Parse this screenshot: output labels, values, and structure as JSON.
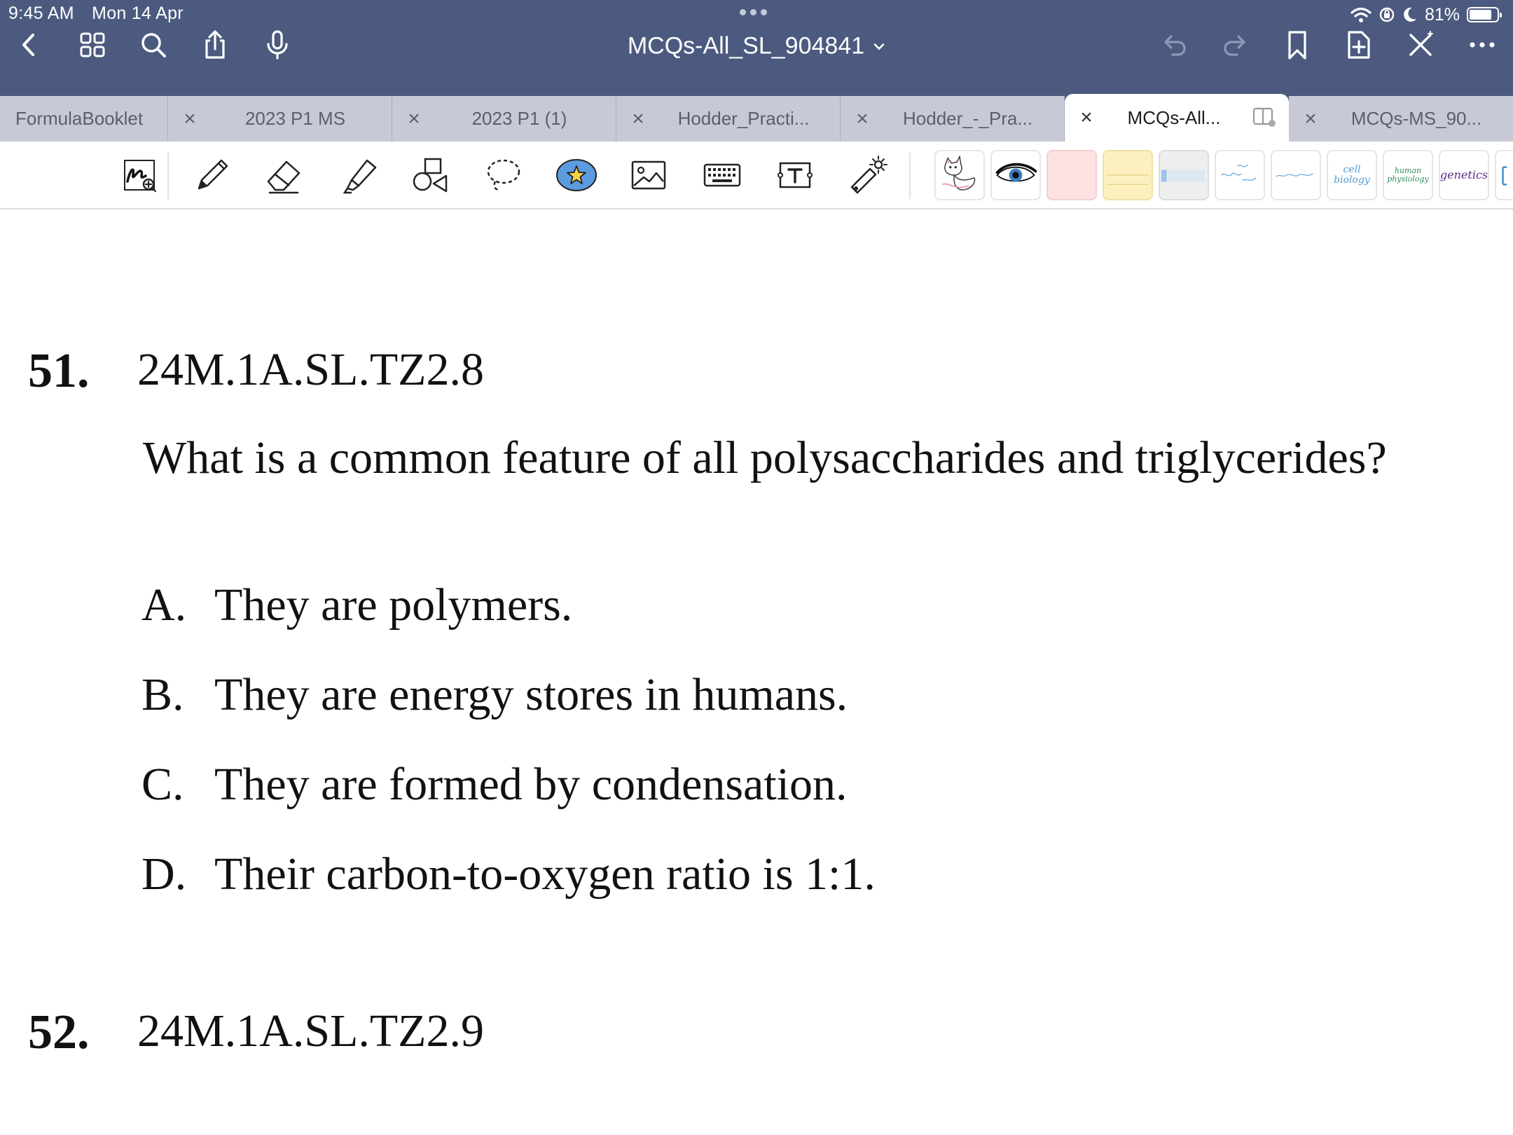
{
  "status_bar": {
    "time": "9:45 AM",
    "date": "Mon 14 Apr",
    "battery_percent": "81%",
    "battery_level": 0.81
  },
  "nav": {
    "document_title": "MCQs-All_SL_904841",
    "left_icons": [
      "back-chevron-icon",
      "grid-icon",
      "search-icon",
      "share-icon",
      "microphone-icon"
    ],
    "right_icons": [
      "undo-icon",
      "redo-icon",
      "bookmark-icon",
      "add-page-icon",
      "close-x-icon",
      "more-icon"
    ]
  },
  "tabs": [
    {
      "label": "FormulaBooklet",
      "active": false
    },
    {
      "label": "2023 P1 MS",
      "active": false
    },
    {
      "label": "2023 P1  (1)",
      "active": false
    },
    {
      "label": "Hodder_Practi...",
      "active": false
    },
    {
      "label": "Hodder_-_Pra...",
      "active": false
    },
    {
      "label": "MCQs-All...",
      "active": true
    },
    {
      "label": "MCQs-MS_90...",
      "active": false
    }
  ],
  "toolbar": {
    "tools": [
      "handwriting-lasso-icon",
      "pen-icon",
      "eraser-icon",
      "highlighter-icon",
      "shapes-icon",
      "lasso-icon",
      "elements-star-icon",
      "image-icon",
      "keyboard-icon",
      "text-box-icon",
      "laser-pointer-icon"
    ],
    "sticker_texts": {
      "cell_biology": "cell biology",
      "human_physiology": "human physiology",
      "genetics": "genetics"
    },
    "colors": {
      "pink_note": "#fde1e3",
      "yellow_note": "#fdf0bf",
      "grey_note": "#eeeeee",
      "genetics_ink": "#5b2a86"
    }
  },
  "questions": [
    {
      "number": "51.",
      "code": "24M.1A.SL.TZ2.8",
      "text": "What is a common feature of all polysaccharides and triglycerides?",
      "options": [
        {
          "letter": "A.",
          "text": "They are polymers."
        },
        {
          "letter": "B.",
          "text": "They are energy stores in humans."
        },
        {
          "letter": "C.",
          "text": "They are formed by condensation."
        },
        {
          "letter": "D.",
          "text": "Their carbon-to-oxygen ratio is 1:1."
        }
      ]
    },
    {
      "number": "52.",
      "code": "24M.1A.SL.TZ2.9"
    }
  ]
}
